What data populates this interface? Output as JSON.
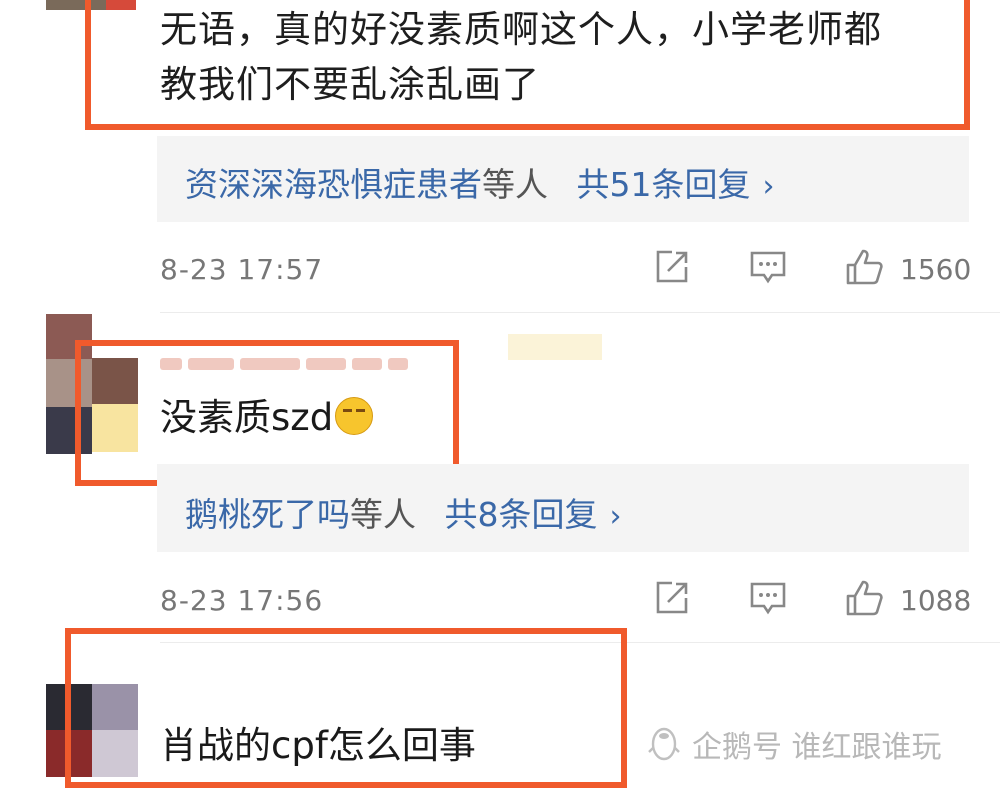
{
  "comments": [
    {
      "text": "无语，真的好没素质啊这个人，小学老师都教我们不要乱涂乱画了",
      "line1": "无语，真的好没素质啊这个人，小学老师都",
      "line2": "教我们不要乱涂乱画了",
      "replies": {
        "who": "资深深海恐惧症患者",
        "suffix": "等人",
        "count_label": "共51条回复",
        "chevron": "›"
      },
      "time": "8-23 17:57",
      "likes": "1560"
    },
    {
      "text": "没素质szd",
      "replies": {
        "who": "鹅桃死了吗",
        "suffix": "等人",
        "count_label": "共8条回复",
        "chevron": "›"
      },
      "time": "8-23 17:56",
      "likes": "1088"
    },
    {
      "text": "肖战的cpf怎么回事"
    }
  ],
  "watermark": "企鹅号 谁红跟谁玩",
  "icons": [
    "share-icon",
    "comment-icon",
    "like-icon",
    "penguin-icon"
  ],
  "colors": {
    "highlight_border": "#f05a2c",
    "link": "#3a68a8",
    "reply_bg": "#f4f4f4"
  }
}
